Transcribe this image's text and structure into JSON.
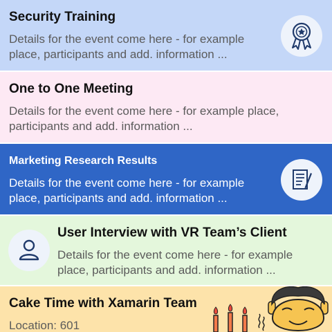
{
  "events": [
    {
      "title": "Security Training",
      "description_line1": "Details for the event come here - for example",
      "description_line2": "place, participants and add. information ..."
    },
    {
      "title": "One to One Meeting",
      "description_line1": "Details for the event come here - for example place,",
      "description_line2": "participants and add. information ..."
    },
    {
      "title": "Marketing Research Results",
      "description_line1": "Details for the event come here - for example",
      "description_line2": "place, participants and add. information ..."
    },
    {
      "title": "User Interview with VR Team’s Client",
      "description_line1": "Details for the event come here - for example",
      "description_line2": "place, participants and add. information ..."
    },
    {
      "title": "Cake Time with Xamarin Team",
      "location": "Location: 601"
    }
  ],
  "colors": {
    "security": "#c4d7f8",
    "meeting": "#fde9f4",
    "marketing": "#2f66c6",
    "interview": "#e4f7dc",
    "cake": "#fde3aa",
    "icon_stroke": "#1f3a6b"
  }
}
